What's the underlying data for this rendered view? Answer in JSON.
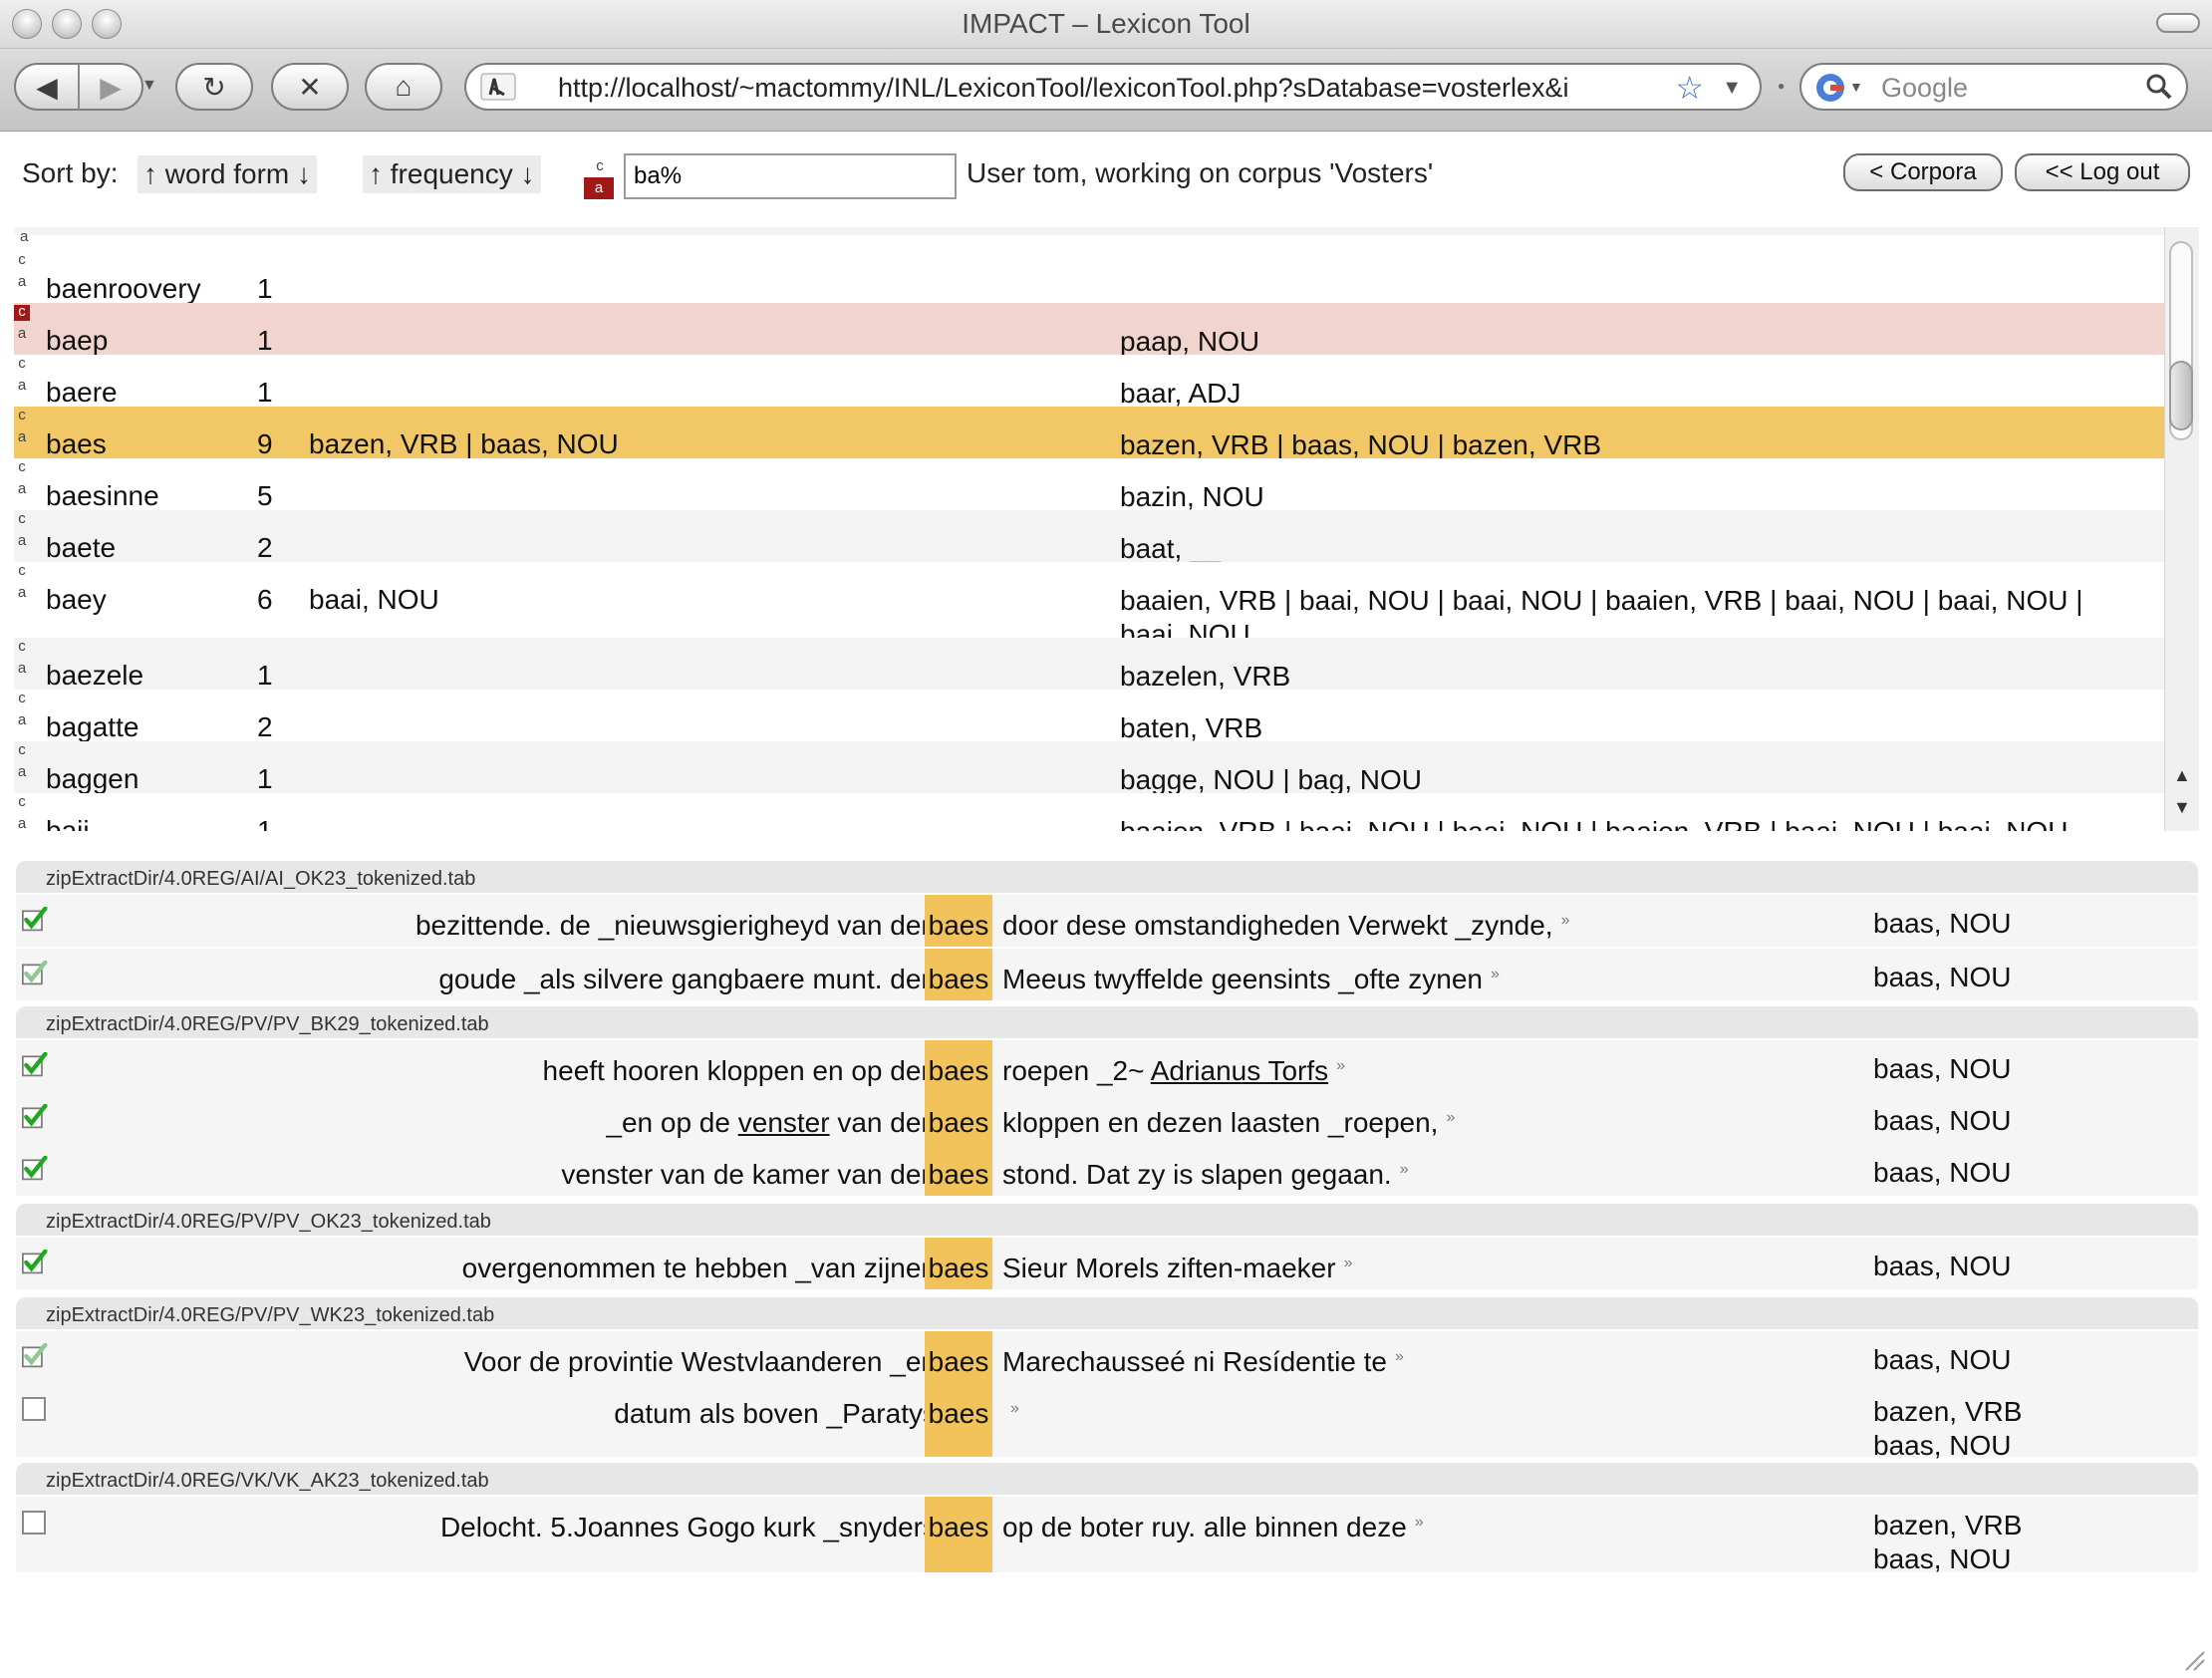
{
  "window": {
    "title": "IMPACT – Lexicon Tool"
  },
  "toolbar": {
    "back_label": "◀",
    "forward_label": "▶",
    "reload_label": "↻",
    "stop_label": "✕",
    "home_label": "⌂",
    "url": "http://localhost/~mactommy/INL/LexiconTool/lexiconTool.php?sDatabase=vosterlex&i",
    "search_placeholder": "Google"
  },
  "header": {
    "sort_by": "Sort by:",
    "sort_word_form": "↑ word form ↓",
    "sort_frequency": "↑ frequency ↓",
    "filter_value": "ba%",
    "user_text": "User tom, working on corpus 'Vosters'",
    "corpora_button": "< Corpora",
    "logout_button": "<< Log out",
    "case_c": "c",
    "case_a": "a"
  },
  "wordlist": [
    {
      "word": "baenroovery",
      "freq": "1",
      "lemmas": "",
      "analyses": ""
    },
    {
      "word": "baep",
      "freq": "1",
      "lemmas": "",
      "analyses": "paap, NOU"
    },
    {
      "word": "baere",
      "freq": "1",
      "lemmas": "",
      "analyses": "baar, ADJ"
    },
    {
      "word": "baes",
      "freq": "9",
      "lemmas": "bazen, VRB | baas, NOU",
      "analyses": "bazen, VRB | baas, NOU | bazen, VRB"
    },
    {
      "word": "baesinne",
      "freq": "5",
      "lemmas": "",
      "analyses": "bazin, NOU"
    },
    {
      "word": "baete",
      "freq": "2",
      "lemmas": "",
      "analyses": "baat, __"
    },
    {
      "word": "baey",
      "freq": "6",
      "lemmas": "baai, NOU",
      "analyses": "baaien, VRB | baai, NOU | baai, NOU | baaien, VRB | baai, NOU | baai, NOU | baai, NOU,"
    },
    {
      "word": "baezele",
      "freq": "1",
      "lemmas": "",
      "analyses": "bazelen, VRB"
    },
    {
      "word": "bagatte",
      "freq": "2",
      "lemmas": "",
      "analyses": "baten, VRB"
    },
    {
      "word": "baggen",
      "freq": "1",
      "lemmas": "",
      "analyses": "bagge, NOU | bag, NOU"
    },
    {
      "word": "baij",
      "freq": "1",
      "lemmas": "",
      "analyses": "baaien, VRB | baai, NOU | baai, NOU | baaien, VRB | baai, NOU | baai, NOU"
    }
  ],
  "concordance": {
    "keyword": "baes",
    "more_glyph": "»",
    "groups": [
      {
        "file": "zipExtractDir/4.0REG/AI/AI_OK23_tokenized.tab",
        "rows": [
          {
            "left": "bezittende. de _nieuwsgierigheyd van den",
            "right": "door dese omstandigheden Verwekt _zynde,",
            "lemma": "baas, NOU",
            "check": "bold"
          },
          {
            "left": "goude _als silvere gangbaere munt. den",
            "right": "Meeus twyffelde geensints _ofte zynen",
            "lemma": "baas, NOU",
            "check": "light"
          }
        ]
      },
      {
        "file": "zipExtractDir/4.0REG/PV/PV_BK29_tokenized.tab",
        "rows": [
          {
            "left": "heeft hooren kloppen en op den",
            "right": "roepen _2~",
            "right_link": "Adrianus Torfs",
            "lemma": "baas, NOU",
            "check": "bold"
          },
          {
            "left_pre": "_en op de",
            "left_link": "venster",
            "left_post": "van den",
            "right": "kloppen en dezen laasten _roepen,",
            "lemma": "baas, NOU",
            "check": "bold"
          },
          {
            "left": "venster van de kamer van den",
            "right": "stond. Dat zy is slapen gegaan.",
            "lemma": "baas, NOU",
            "check": "bold"
          }
        ]
      },
      {
        "file": "zipExtractDir/4.0REG/PV/PV_OK23_tokenized.tab",
        "rows": [
          {
            "left": "overgenommen te hebben _van zijnen",
            "right": "Sieur Morels ziften-maeker",
            "lemma": "baas, NOU",
            "check": "bold"
          }
        ]
      },
      {
        "file": "zipExtractDir/4.0REG/PV/PV_WK23_tokenized.tab",
        "rows": [
          {
            "left": "Voor de provintie Westvlaanderen _en",
            "right": "Marechausseé ni Resídentie te",
            "lemma": "baas, NOU",
            "check": "light"
          },
          {
            "left": "datum als boven _Paratys",
            "right": "",
            "lemma": "bazen, VRB",
            "lemma2": "baas, NOU",
            "check": "none"
          }
        ]
      },
      {
        "file": "zipExtractDir/4.0REG/VK/VK_AK23_tokenized.tab",
        "rows": [
          {
            "left": "Delocht. 5.Joannes Gogo kurk _snyders",
            "right": "op de boter ruy. alle binnen deze",
            "lemma": "bazen, VRB",
            "lemma2": "baas, NOU",
            "check": "none"
          }
        ]
      }
    ]
  },
  "colors": {
    "highlight_row": "#f2c765",
    "selected_row": "#f2d4cf",
    "keyword_bg": "#f1c35a",
    "check_green": "#1fa81f"
  }
}
